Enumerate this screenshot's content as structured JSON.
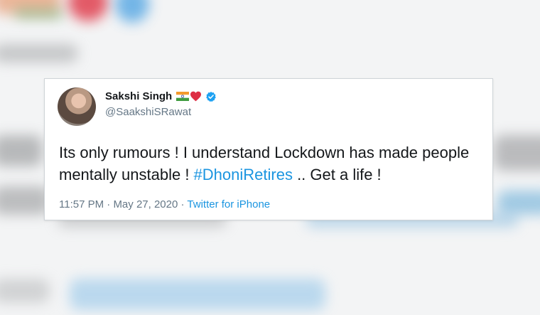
{
  "tweet": {
    "display_name": "Sakshi Singh",
    "handle": "@SaakshiSRawat",
    "text_before": "Its only rumours ! I understand Lockdown has made people mentally unstable ! ",
    "hashtag": "#DhoniRetires",
    "text_after": " .. Get a life !",
    "time": "11:57 PM",
    "date": "May 27, 2020",
    "separator": "·",
    "source": "Twitter for iPhone",
    "name_emojis": [
      "india-flag",
      "red-heart"
    ],
    "verified": true
  },
  "colors": {
    "link": "#1b95e0",
    "text": "#14171a",
    "secondary": "#657786",
    "card_bg": "#ffffff"
  }
}
